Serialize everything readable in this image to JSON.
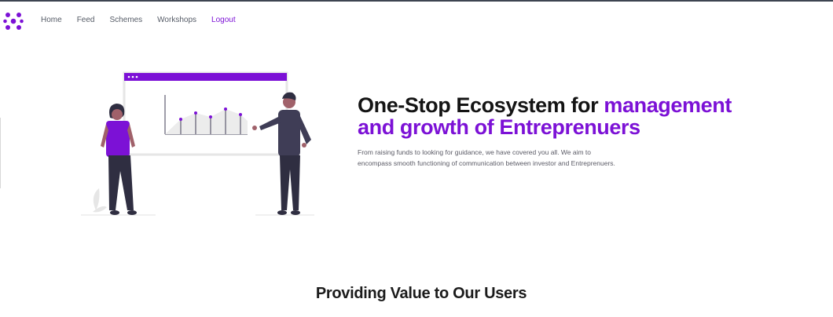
{
  "nav": {
    "logo_icon": "dots-logo-icon",
    "links": [
      {
        "label": "Home"
      },
      {
        "label": "Feed"
      },
      {
        "label": "Schemes"
      },
      {
        "label": "Workshops"
      },
      {
        "label": "Logout"
      }
    ]
  },
  "hero": {
    "title_part1": "One-Stop Ecosystem for ",
    "title_highlight_line1": "management",
    "title_highlight_line2": "and growth of Entreprenuers",
    "description": "From raising funds to looking for guidance, we have covered you all. We aim to encompass smooth functioning of communication between investor and Entreprenuers.",
    "illustration": "presentation-illustration"
  },
  "section": {
    "title": "Providing Value to Our Users"
  },
  "colors": {
    "accent": "#7c11d6",
    "text_dark": "#141414",
    "nav_text": "#555b66"
  }
}
